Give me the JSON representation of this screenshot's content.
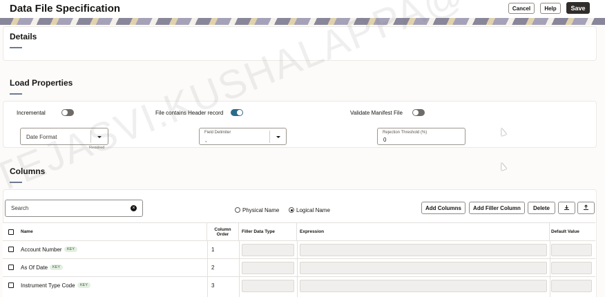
{
  "header": {
    "title": "Data File Specification",
    "cancel_label": "Cancel",
    "help_label": "Help",
    "save_label": "Save"
  },
  "details": {
    "title": "Details"
  },
  "load_properties": {
    "title": "Load Properties",
    "incremental_label": "Incremental",
    "incremental_on": false,
    "header_record_label": "File contains Header record",
    "header_record_on": true,
    "validate_manifest_label": "Validate Manifest File",
    "validate_manifest_on": false,
    "date_format_placeholder": "Date Format",
    "date_format_hint": "Required",
    "field_delimiter_label": "Field Delimiter",
    "field_delimiter_value": ",",
    "rejection_threshold_label": "Rejection Threshold (%)",
    "rejection_threshold_value": "0"
  },
  "columns": {
    "title": "Columns",
    "search_placeholder": "Search",
    "name_options": [
      {
        "label": "Physical Name",
        "selected": false
      },
      {
        "label": "Logical Name",
        "selected": true
      }
    ],
    "add_columns_label": "Add Columns",
    "add_filler_label": "Add Filler Column",
    "delete_label": "Delete",
    "table": {
      "headers": {
        "name": "Name",
        "column_order_1": "Column",
        "column_order_2": "Order",
        "filler_type": "Filler Data Type",
        "expression": "Expression",
        "default_value": "Default Value"
      },
      "rows": [
        {
          "name": "Account Number",
          "badge": "KEY",
          "order": "1"
        },
        {
          "name": "As Of Date",
          "badge": "KEY",
          "order": "2"
        },
        {
          "name": "Instrument Type Code",
          "badge": "KEY",
          "order": "3"
        }
      ]
    }
  },
  "watermark": "TEJASVI.KUSHALAPPA@ORACLE.COM",
  "icons": {
    "clear": "clear-icon",
    "download": "download-icon",
    "upload": "upload-icon",
    "dropdown": "chevron-down-icon"
  },
  "colors": {
    "primary_button": "#312d2a",
    "toggle_on": "#2b6b8a",
    "badge_bg": "#e4efe2"
  }
}
